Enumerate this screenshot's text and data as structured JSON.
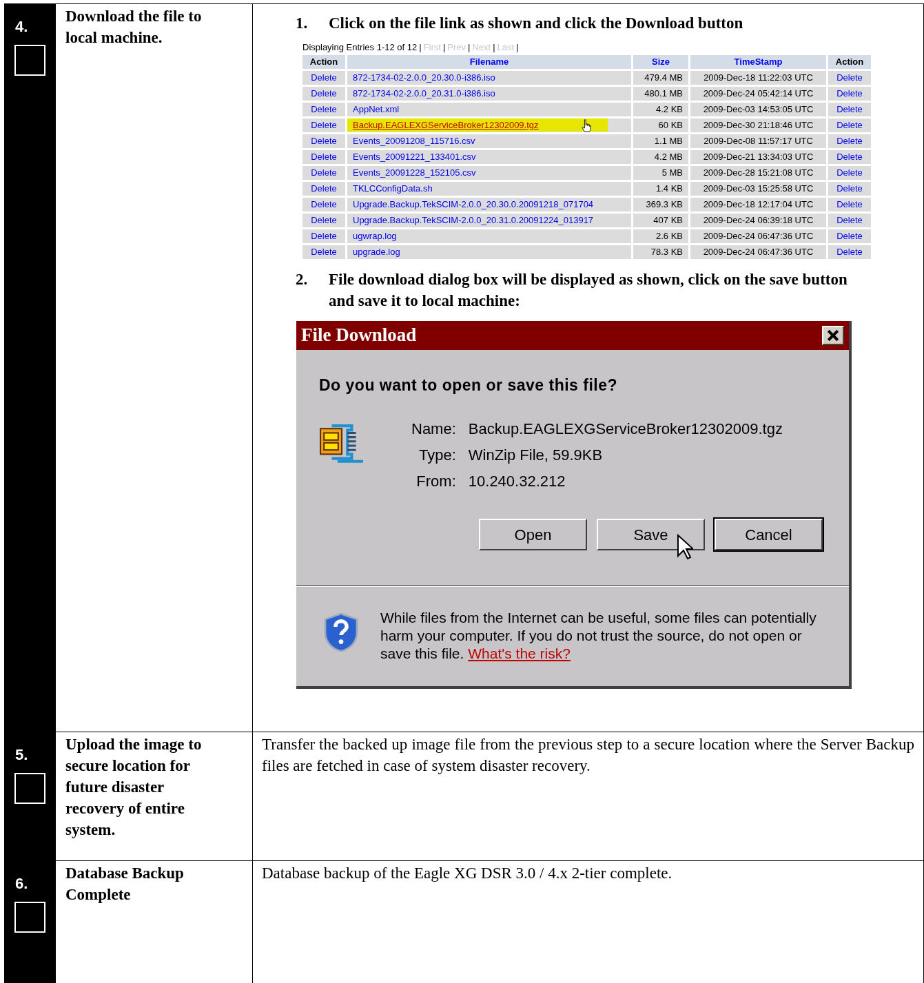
{
  "steps": [
    {
      "number": "4.",
      "checked": false,
      "title": "Download the file to local machine.",
      "kind": "screenshots",
      "instructions": [
        {
          "number": "1.",
          "text": "Click on the file link as shown and click the Download button",
          "kind": "file_list"
        },
        {
          "number": "2.",
          "text": "File download dialog box will be displayed as shown, click on the save button and save it to local machine:",
          "kind": "dialog"
        }
      ]
    },
    {
      "number": "5.",
      "checked": false,
      "title": "Upload the image to secure location for future disaster recovery of entire system.",
      "kind": "text",
      "text": "Transfer the backed up image file from the previous step to a secure location where the Server Backup files are fetched in case of system disaster recovery."
    },
    {
      "number": "6.",
      "checked": false,
      "title": "Database Backup Complete",
      "kind": "text",
      "text": "Database backup of the Eagle XG DSR 3.0 / 4.x 2-tier complete."
    }
  ],
  "file_list": {
    "summary": "Displaying Entries 1-12 of 12",
    "separator": "|",
    "links": [
      {
        "label": "First",
        "disabled": true
      },
      {
        "label": "Prev",
        "disabled": true
      },
      {
        "label": "Next",
        "disabled": true
      },
      {
        "label": "Last",
        "disabled": true
      }
    ],
    "columns": [
      "Action",
      "Filename",
      "Size",
      "TimeStamp",
      "Action"
    ],
    "rows": [
      {
        "action": "Delete",
        "filename": "872-1734-02-2.0.0_20.30.0-i386.iso",
        "size": "479.4 MB",
        "timestamp": "2009-Dec-18 11:22:03 UTC",
        "action_2": "Delete",
        "selected": false
      },
      {
        "action": "Delete",
        "filename": "872-1734-02-2.0.0_20.31.0-i386.iso",
        "size": "480.1 MB",
        "timestamp": "2009-Dec-24 05:42:14 UTC",
        "action_2": "Delete",
        "selected": false
      },
      {
        "action": "Delete",
        "filename": "AppNet.xml",
        "size": "4.2 KB",
        "timestamp": "2009-Dec-03 14:53:05 UTC",
        "action_2": "Delete",
        "selected": false
      },
      {
        "action": "Delete",
        "filename": "Backup.EAGLEXGServiceBroker12302009.tgz",
        "size": "60 KB",
        "timestamp": "2009-Dec-30 21:18:46 UTC",
        "action_2": "Delete",
        "selected": true
      },
      {
        "action": "Delete",
        "filename": "Events_20091208_115716.csv",
        "size": "1.1 MB",
        "timestamp": "2009-Dec-08 11:57:17 UTC",
        "action_2": "Delete",
        "selected": false
      },
      {
        "action": "Delete",
        "filename": "Events_20091221_133401.csv",
        "size": "4.2 MB",
        "timestamp": "2009-Dec-21 13:34:03 UTC",
        "action_2": "Delete",
        "selected": false
      },
      {
        "action": "Delete",
        "filename": "Events_20091228_152105.csv",
        "size": "5 MB",
        "timestamp": "2009-Dec-28 15:21:08 UTC",
        "action_2": "Delete",
        "selected": false
      },
      {
        "action": "Delete",
        "filename": "TKLCConfigData.sh",
        "size": "1.4 KB",
        "timestamp": "2009-Dec-03 15:25:58 UTC",
        "action_2": "Delete",
        "selected": false
      },
      {
        "action": "Delete",
        "filename": "Upgrade.Backup.TekSCIM-2.0.0_20.30.0.20091218_071704",
        "size": "369.3 KB",
        "timestamp": "2009-Dec-18 12:17:04 UTC",
        "action_2": "Delete",
        "selected": false
      },
      {
        "action": "Delete",
        "filename": "Upgrade.Backup.TekSCIM-2.0.0_20.31.0.20091224_013917",
        "size": "407 KB",
        "timestamp": "2009-Dec-24 06:39:18 UTC",
        "action_2": "Delete",
        "selected": false
      },
      {
        "action": "Delete",
        "filename": "ugwrap.log",
        "size": "2.6 KB",
        "timestamp": "2009-Dec-24 06:47:36 UTC",
        "action_2": "Delete",
        "selected": false
      },
      {
        "action": "Delete",
        "filename": "upgrade.log",
        "size": "78.3 KB",
        "timestamp": "2009-Dec-24 06:47:36 UTC",
        "action_2": "Delete",
        "selected": false
      }
    ]
  },
  "dialog": {
    "title": "File Download",
    "question": "Do you want to open or save this file?",
    "fields": [
      {
        "label": "Name:",
        "value": "Backup.EAGLEXGServiceBroker12302009.tgz"
      },
      {
        "label": "Type:",
        "value": "WinZip File, 59.9KB"
      },
      {
        "label": "From:",
        "value": "10.240.32.212"
      }
    ],
    "buttons": [
      {
        "label": "Open",
        "default": false
      },
      {
        "label": "Save",
        "default": false
      },
      {
        "label": "Cancel",
        "default": true
      }
    ],
    "warning": "While files from the Internet can be useful, some files can potentially harm your computer. If you do not trust the source, do not open or save this file.",
    "warning_link": "What's the risk?"
  }
}
